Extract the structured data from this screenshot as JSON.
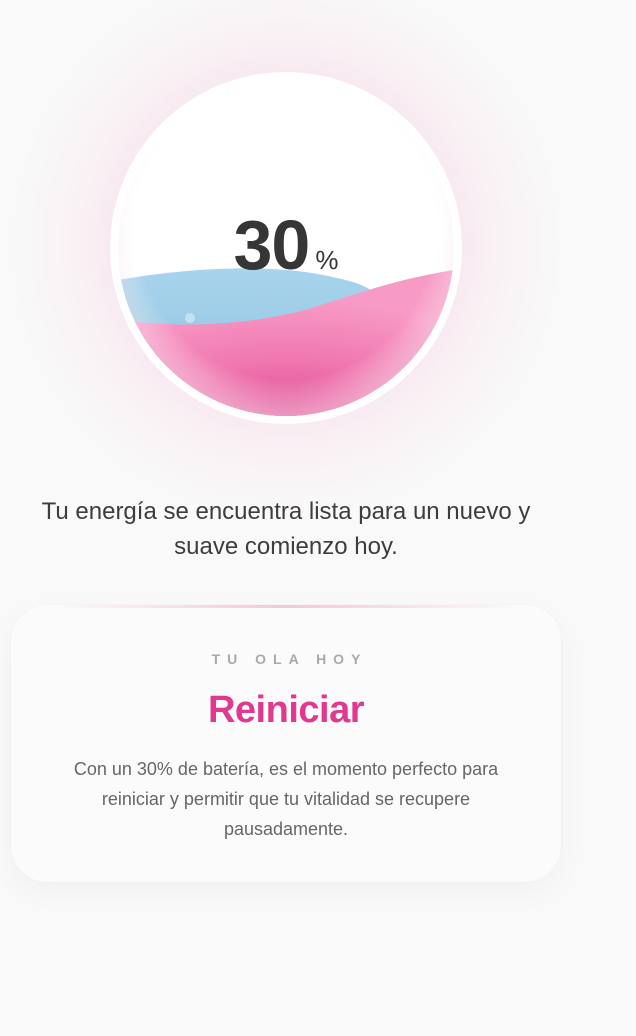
{
  "energy": {
    "value": "30",
    "unit": "%",
    "fill_level": 0.3,
    "message": "Tu energía se encuentra lista para un nuevo y suave comienzo hoy."
  },
  "card": {
    "eyebrow": "TU OLA HOY",
    "title": "Reiniciar",
    "description": "Con un 30% de batería, es el momento perfecto para reiniciar y permitir que tu vitalidad se recupere pausadamente."
  },
  "colors": {
    "accent": "#e0398f",
    "wave_pink": "#f07fb5",
    "wave_blue": "#a9d3ea",
    "background": "#f9f9f9"
  }
}
